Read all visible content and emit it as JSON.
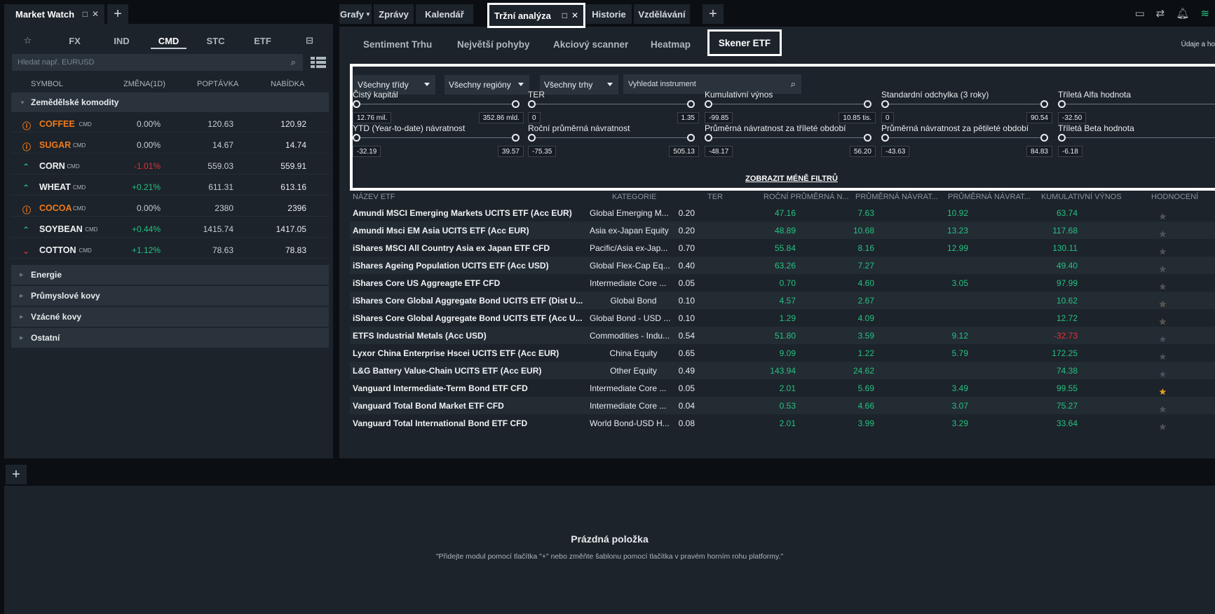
{
  "market_watch": {
    "title": "Market Watch",
    "tabs": [
      "☆",
      "FX",
      "IND",
      "CMD",
      "STC",
      "ETF",
      "⊟"
    ],
    "active_tab": "CMD",
    "search_placeholder": "Hledat např. EURUSD",
    "columns": [
      "SYMBOL",
      "ZMĚNA(1D)",
      "POPTÁVKA",
      "NABÍDKA"
    ],
    "group_open": "Zemědělské komodity",
    "rows": [
      {
        "icon": "ⓘ",
        "symbol": "COFFEE",
        "tag": "CMD",
        "change": "0.00%",
        "bid": "120.63",
        "ask": "120.92",
        "status": "closed"
      },
      {
        "icon": "ⓘ",
        "symbol": "SUGAR",
        "tag": "CMD",
        "change": "0.00%",
        "bid": "14.67",
        "ask": "14.74",
        "status": "closed"
      },
      {
        "icon": "⌃",
        "symbol": "CORN",
        "tag": "CMD",
        "change": "-1.01%",
        "bid": "559.03",
        "ask": "559.91",
        "status": "down"
      },
      {
        "icon": "⌃",
        "symbol": "WHEAT",
        "tag": "CMD",
        "change": "+0.21%",
        "bid": "611.31",
        "ask": "613.16",
        "status": "up"
      },
      {
        "icon": "ⓘ",
        "symbol": "COCOA",
        "tag": "CMD",
        "change": "0.00%",
        "bid": "2380",
        "ask": "2396",
        "status": "closed"
      },
      {
        "icon": "⌃",
        "symbol": "SOYBEAN",
        "tag": "CMD",
        "change": "+0.44%",
        "bid": "1415.74",
        "ask": "1417.05",
        "status": "up"
      },
      {
        "icon": "⌄",
        "symbol": "COTTON",
        "tag": "CMD",
        "change": "+1.12%",
        "bid": "78.63",
        "ask": "78.83",
        "status": "updown"
      }
    ],
    "groups_closed": [
      "Energie",
      "Průmyslové kovy",
      "Vzácné kovy",
      "Ostatní"
    ]
  },
  "top_tabs": {
    "grafy": "Grafy",
    "zpravy": "Zprávy",
    "kalendar": "Kalendář",
    "trzni": "Tržní analýza",
    "historie": "Historie",
    "vzdelavani": "Vzdělávání"
  },
  "sub_tabs": [
    "Sentiment Trhu",
    "Největší pohyby",
    "Akciový scanner",
    "Heatmap"
  ],
  "sub_tab_active": "Skener ETF",
  "info_text": "Údaje a ho",
  "filters": {
    "classes": "Všechny třídy",
    "regions": "Všechny regióny",
    "markets": "Všechny trhy",
    "search_placeholder": "Vyhledat instrument",
    "sliders_row1": [
      {
        "label": "Čistý kapitál",
        "min": "12.76 mil.",
        "max": "352.86 mld."
      },
      {
        "label": "TER",
        "min": "0",
        "max": "1.35"
      },
      {
        "label": "Kumulativní výnos",
        "min": "-99.85",
        "max": "10.85 tis."
      },
      {
        "label": "Standardní odchylka (3 roky)",
        "min": "0",
        "max": "90.54"
      },
      {
        "label": "Tříletá Alfa hodnota",
        "min": "-32.50",
        "max": ""
      }
    ],
    "sliders_row2": [
      {
        "label": "YTD (Year-to-date) návratnost",
        "min": "-32.19",
        "max": "39.57"
      },
      {
        "label": "Roční průměrná návratnost",
        "min": "-75.35",
        "max": "505.13"
      },
      {
        "label": "Průměrná návratnost za tříleté období",
        "min": "-48.17",
        "max": "56.20"
      },
      {
        "label": "Průměrná návratnost za pětileté období",
        "min": "-43.63",
        "max": "84.83"
      },
      {
        "label": "Tříletá Beta hodnota",
        "min": "-6.18",
        "max": ""
      }
    ],
    "show_less": "ZOBRAZIT MÉNĚ FILTRŮ"
  },
  "etf_table": {
    "columns": [
      "NÁZEV ETF",
      "KATEGORIE",
      "TER",
      "ROČNÍ PRŮMĚRNÁ N...",
      "PRŮMĚRNÁ NÁVRAT...",
      "PRŮMĚRNÁ NÁVRAT...",
      "KUMULATIVNÍ VÝNOS",
      "HODNOCENÍ"
    ],
    "rows": [
      {
        "name": "Amundi MSCI Emerging Markets UCITS ETF (Acc EUR)",
        "cat": "Global Emerging M...",
        "ter": "0.20",
        "r1": "47.16",
        "r3": "7.63",
        "r5": "10.92",
        "cum": "63.74",
        "stars": 3
      },
      {
        "name": "Amundi Msci EM Asia UCITS ETF (Acc EUR)",
        "cat": "Asia ex-Japan Equity",
        "ter": "0.20",
        "r1": "48.89",
        "r3": "10.68",
        "r5": "13.23",
        "cum": "117.68",
        "stars": 3
      },
      {
        "name": "iShares MSCI All Country Asia ex Japan ETF CFD",
        "cat": "Pacific/Asia ex-Jap...",
        "ter": "0.70",
        "r1": "55.84",
        "r3": "8.16",
        "r5": "12.99",
        "cum": "130.11",
        "stars": 2
      },
      {
        "name": "iShares Ageing Population UCITS ETF (Acc USD)",
        "cat": "Global Flex-Cap Eq...",
        "ter": "0.40",
        "r1": "63.26",
        "r3": "7.27",
        "r5": "",
        "cum": "49.40",
        "stars": 3
      },
      {
        "name": "iShares Core US Aggreagte ETF CFD",
        "cat": "Intermediate Core ...",
        "ter": "0.05",
        "r1": "0.70",
        "r3": "4.60",
        "r5": "3.05",
        "cum": "97.99",
        "stars": 3
      },
      {
        "name": "iShares Core Global Aggregate Bond UCITS ETF (Dist U...",
        "cat": "Global Bond",
        "ter": "0.10",
        "r1": "4.57",
        "r3": "2.67",
        "r5": "",
        "cum": "10.62",
        "stars": 4
      },
      {
        "name": "iShares Core Global Aggregate Bond UCITS ETF (Acc U...",
        "cat": "Global Bond - USD ...",
        "ter": "0.10",
        "r1": "1.29",
        "r3": "4.09",
        "r5": "",
        "cum": "12.72",
        "stars": 4
      },
      {
        "name": "ETFS Industrial Metals (Acc USD)",
        "cat": "Commodities - Indu...",
        "ter": "0.54",
        "r1": "51.80",
        "r3": "3.59",
        "r5": "9.12",
        "cum": "-32.73",
        "stars": 0
      },
      {
        "name": "Lyxor China Enterprise Hscei UCITS ETF (Acc EUR)",
        "cat": "China Equity",
        "ter": "0.65",
        "r1": "9.09",
        "r3": "1.22",
        "r5": "5.79",
        "cum": "172.25",
        "stars": 1
      },
      {
        "name": "L&G Battery Value-Chain UCITS ETF (Acc EUR)",
        "cat": "Other Equity",
        "ter": "0.49",
        "r1": "143.94",
        "r3": "24.62",
        "r5": "",
        "cum": "74.38",
        "stars": 0
      },
      {
        "name": "Vanguard Intermediate-Term Bond ETF CFD",
        "cat": "Intermediate Core ...",
        "ter": "0.05",
        "r1": "2.01",
        "r3": "5.69",
        "r5": "3.49",
        "cum": "99.55",
        "stars": 5
      },
      {
        "name": "Vanguard Total Bond Market ETF CFD",
        "cat": "Intermediate Core ...",
        "ter": "0.04",
        "r1": "0.53",
        "r3": "4.66",
        "r5": "3.07",
        "cum": "75.27",
        "stars": 3
      },
      {
        "name": "Vanguard Total International Bond ETF CFD",
        "cat": "World Bond-USD H...",
        "ter": "0.08",
        "r1": "2.01",
        "r3": "3.99",
        "r5": "3.29",
        "cum": "33.64",
        "stars": 3
      }
    ]
  },
  "bottom": {
    "title": "Prázdná položka",
    "subtitle": "\"Přidejte modul pomocí tlačítka \"+\" nebo změňte šablonu pomocí tlačítka v pravém horním rohu platformy.\""
  },
  "colors": {
    "up": "#26c281",
    "down": "#e0343b",
    "warn": "#f07a1a",
    "bg": "#1c232a"
  }
}
